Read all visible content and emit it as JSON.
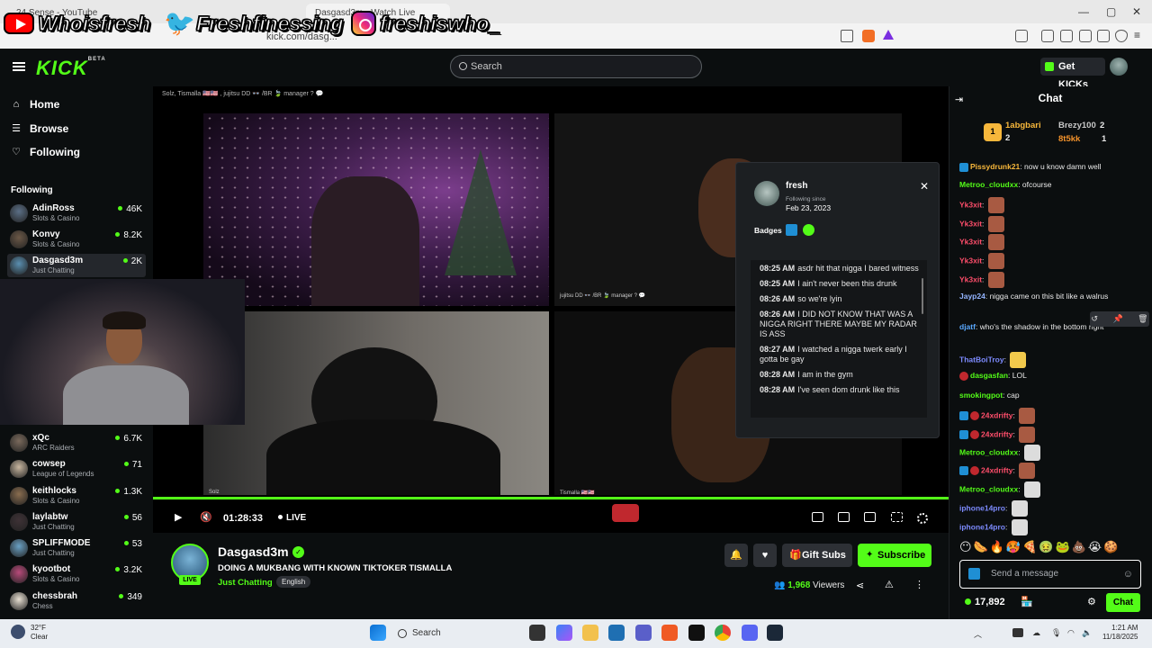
{
  "browser": {
    "tabs": [
      "24 Sense - YouTube",
      "Dasgasd3m - Watch Live"
    ],
    "address": "kick.com/dasg..."
  },
  "overlay": {
    "youtube": "Whoisfresh",
    "twitter": "Freshfinessing",
    "instagram": "freshiswho_"
  },
  "header": {
    "logo": "KICK",
    "logo_tag": "BETA",
    "search_placeholder": "Search",
    "get_kicks": "Get KICKs"
  },
  "sidebar": {
    "nav": [
      {
        "label": "Home",
        "icon": "home-icon"
      },
      {
        "label": "Browse",
        "icon": "browse-icon"
      },
      {
        "label": "Following",
        "icon": "heart-icon"
      }
    ],
    "section_title": "Following",
    "following": [
      {
        "name": "AdinRoss",
        "category": "Slots & Casino",
        "viewers": "46K",
        "color": "#5b6f86"
      },
      {
        "name": "Konvy",
        "category": "Slots & Casino",
        "viewers": "8.2K",
        "color": "#6b5847"
      },
      {
        "name": "Dasgasd3m",
        "category": "Just Chatting",
        "viewers": "2K",
        "color": "#5a8fb0"
      },
      {
        "name": "xQc",
        "category": "ARC Raiders",
        "viewers": "6.7K",
        "color": "#7a6a5c"
      },
      {
        "name": "cowsep",
        "category": "League of Legends",
        "viewers": "71",
        "color": "#c9b7a0"
      },
      {
        "name": "keithlocks",
        "category": "Slots & Casino",
        "viewers": "1.3K",
        "color": "#8a6d4f"
      },
      {
        "name": "laylabtw",
        "category": "Just Chatting",
        "viewers": "56",
        "color": "#3e3236"
      },
      {
        "name": "SPLIFFMODE",
        "category": "Just Chatting",
        "viewers": "53",
        "color": "#6aa1c4"
      },
      {
        "name": "kyootbot",
        "category": "Slots & Casino",
        "viewers": "3.2K",
        "color": "#b84a7a"
      },
      {
        "name": "chessbrah",
        "category": "Chess",
        "viewers": "349",
        "color": "#e8e0d2"
      }
    ]
  },
  "video": {
    "caption": "Solz, Tismalla 🇺🇸🇺🇸 , jujitsu DD 👓 /BR 🍃 manager ? 💬",
    "tile2_caption": "jujitsu DD 👓 /BR 🍃 manager ? 💬",
    "tile4_caption": "Tismalla 🇺🇸🇺🇸",
    "tile3_caption": "Solz",
    "timecode": "01:28:33",
    "live": "LIVE"
  },
  "popup": {
    "username": "fresh",
    "following_since_label": "Following since",
    "following_since": "Feb 23, 2023",
    "badges_label": "Badges",
    "history": [
      {
        "time": "08:25 AM",
        "text": "asdr hit that nigga I bared witness"
      },
      {
        "time": "08:25 AM",
        "text": "I ain't never been this drunk"
      },
      {
        "time": "08:26 AM",
        "text": "so we're lyin"
      },
      {
        "time": "08:26 AM",
        "text": "I DID NOT KNOW THAT WAS A NIGGA RIGHT THERE MAYBE MY RADAR IS ASS"
      },
      {
        "time": "08:27 AM",
        "text": "I watched a nigga twerk early I gotta be gay"
      },
      {
        "time": "08:28 AM",
        "text": "I am in the gym"
      },
      {
        "time": "08:28 AM",
        "text": "I've seen dom drunk like this"
      }
    ]
  },
  "stream": {
    "channel": "Dasgasd3m",
    "live_badge": "LIVE",
    "title": "DOING A MUKBANG WITH KNOWN TIKTOKER TISMALLA",
    "category": "Just Chatting",
    "language": "English",
    "gift_subs": "Gift Subs",
    "subscribe": "Subscribe",
    "viewers": "1,968",
    "viewers_label": "Viewers"
  },
  "chat": {
    "title": "Chat",
    "leaderboard": [
      {
        "rank": "1",
        "name": "1abgbari",
        "count": "2"
      },
      {
        "name": "Brezy100",
        "count": "2"
      },
      {
        "name": "8t5kk",
        "count": "1"
      }
    ],
    "messages": [
      {
        "user": "Pissydrunk21",
        "color": "#f7b73b",
        "text": "now u know damn well"
      },
      {
        "user": "Metroo_cloudxx",
        "color": "#53fc18",
        "text": "ofcourse"
      },
      {
        "user": "Yk3xit",
        "color": "#ff4e6b",
        "text": ""
      },
      {
        "user": "Yk3xit",
        "color": "#ff4e6b",
        "text": ""
      },
      {
        "user": "Yk3xit",
        "color": "#ff4e6b",
        "text": ""
      },
      {
        "user": "Yk3xit",
        "color": "#ff4e6b",
        "text": ""
      },
      {
        "user": "Yk3xit",
        "color": "#ff4e6b",
        "text": ""
      },
      {
        "user": "Jayp24",
        "color": "#93b4ff",
        "text": "nigga came on this bit like a walrus"
      },
      {
        "user": "djatf",
        "color": "#5aa9ff",
        "text": "who's the shadow in the bottom right"
      },
      {
        "user": "ThatBoiTroy",
        "color": "#7d8bff",
        "text": ""
      },
      {
        "user": "dasgasfan",
        "color": "#53fc18",
        "text": "LOL"
      },
      {
        "user": "smokingpot",
        "color": "#53fc18",
        "text": "cap"
      },
      {
        "user": "24xdrifty",
        "color": "#ff4e6b",
        "text": ""
      },
      {
        "user": "24xdrifty",
        "color": "#ff4e6b",
        "text": ""
      },
      {
        "user": "Metroo_cloudxx",
        "color": "#53fc18",
        "text": ""
      },
      {
        "user": "24xdrifty",
        "color": "#ff4e6b",
        "text": ""
      },
      {
        "user": "Metroo_cloudxx",
        "color": "#53fc18",
        "text": ""
      },
      {
        "user": "iphone14pro",
        "color": "#7d8bff",
        "text": ""
      },
      {
        "user": "iphone14pro",
        "color": "#7d8bff",
        "text": ""
      }
    ],
    "input_placeholder": "Send a message",
    "kicks": "17,892",
    "chat_button": "Chat"
  },
  "taskbar": {
    "temp": "32°F",
    "condition": "Clear",
    "search": "Search",
    "time": "1:21 AM",
    "date": "11/18/2025"
  }
}
